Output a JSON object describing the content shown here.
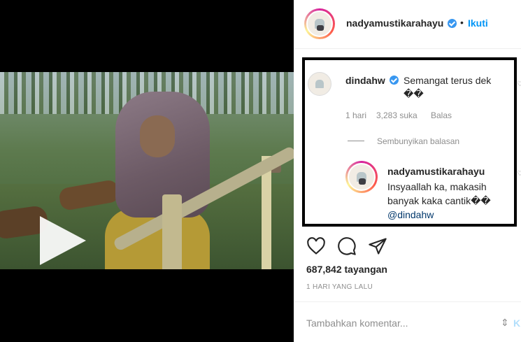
{
  "post": {
    "author": "nadyamustikarahayu",
    "follow_label": "Ikuti",
    "separator": "•"
  },
  "comment": {
    "user": "dindahw",
    "text": "Semangat terus dek ��",
    "time": "1 hari",
    "likes": "3,283 suka",
    "reply_label": "Balas",
    "hide_replies": "Sembunyikan balasan"
  },
  "reply": {
    "user": "nadyamustikarahayu",
    "text": "Insyaallah ka, makasih banyak kaka cantik��",
    "mention": "@dindahw"
  },
  "stats": {
    "views": "687,842 tayangan",
    "time_ago": "1 HARI YANG LALU"
  },
  "comment_box": {
    "placeholder": "Tambahkan komentar...",
    "post_label": "K"
  },
  "icons": {
    "play": "play-icon",
    "verified": "verified-badge-icon",
    "heart": "heart-icon",
    "comment": "comment-icon",
    "share": "share-icon",
    "emoji": "emoji-icon"
  },
  "colors": {
    "accent": "#0095f6",
    "verified": "#3897f0",
    "muted": "#8e8e8e"
  }
}
